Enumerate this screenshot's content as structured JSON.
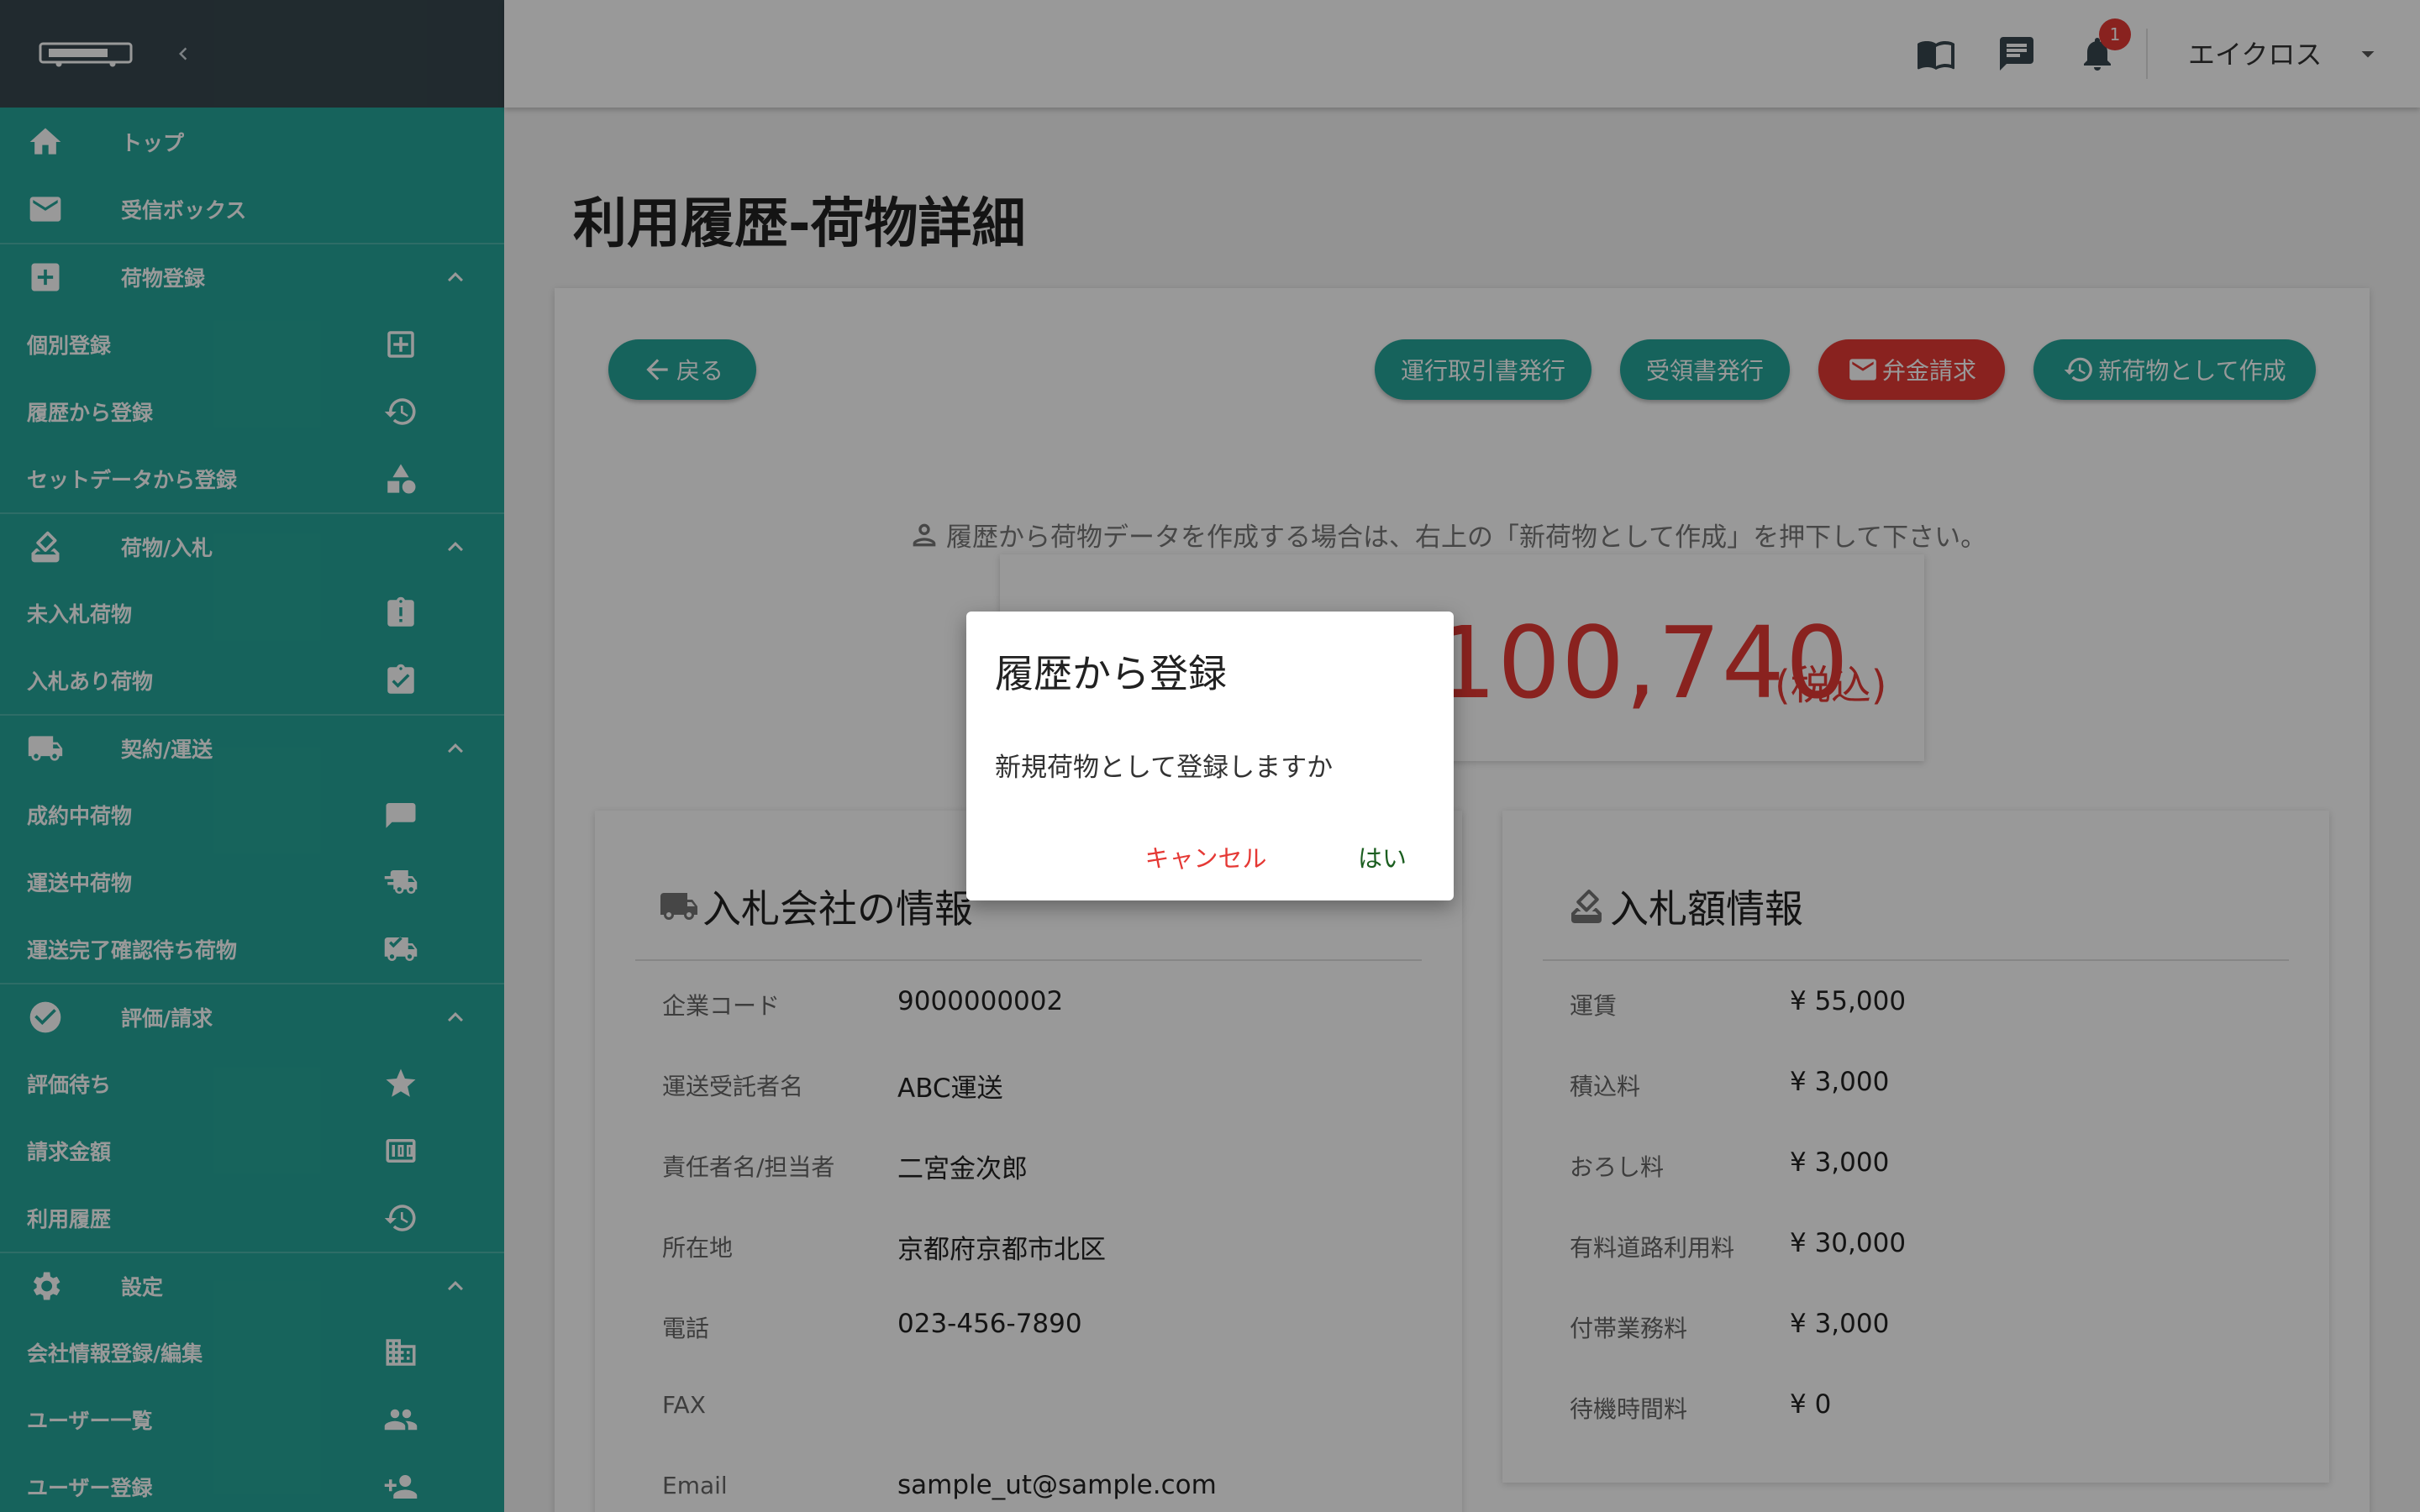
{
  "topbar": {
    "user_name": "エイクロス",
    "notification_count": "1"
  },
  "sidebar": {
    "top": "トップ",
    "inbox": "受信ボックス",
    "cargo_register": "荷物登録",
    "individual_register": "個別登録",
    "history_register": "履歴から登録",
    "set_data_register": "セットデータから登録",
    "cargo_bid": "荷物/入札",
    "unbid_cargo": "未入札荷物",
    "bid_cargo": "入札あり荷物",
    "contract_transport": "契約/運送",
    "contracted_cargo": "成約中荷物",
    "in_transit_cargo": "運送中荷物",
    "awaiting_confirmation_cargo": "運送完了確認待ち荷物",
    "review_billing": "評価/請求",
    "awaiting_review": "評価待ち",
    "billing_amount": "請求金額",
    "usage_history": "利用履歴",
    "settings": "設定",
    "company_info_edit": "会社情報登録/編集",
    "user_list": "ユーザー一覧",
    "user_register": "ユーザー登録"
  },
  "main": {
    "page_title": "利用履歴-荷物詳細",
    "back_label": "戻る",
    "operation_doc_label": "運行取引書発行",
    "receipt_label": "受領書発行",
    "reimbursement_label": "弁金請求",
    "new_cargo_label": "新荷物として作成",
    "notice": "履歴から荷物データを作成する場合は、右上の「新荷物として作成」を押下して下さい。",
    "amount": "100,740",
    "tax_label": "(税込)"
  },
  "bidder_panel": {
    "title": "入札会社の情報",
    "rows": [
      {
        "label": "企業コード",
        "value": "9000000002"
      },
      {
        "label": "運送受託者名",
        "value": "ABC運送"
      },
      {
        "label": "責任者名/担当者",
        "value": "二宮金次郎"
      },
      {
        "label": "所在地",
        "value": "京都府京都市北区"
      },
      {
        "label": "電話",
        "value": "023-456-7890"
      },
      {
        "label": "FAX",
        "value": ""
      },
      {
        "label": "Email",
        "value": "sample_ut@sample.com"
      }
    ]
  },
  "bid_amount_panel": {
    "title": "入札額情報",
    "rows": [
      {
        "label": "運賃",
        "value": "¥ 55,000"
      },
      {
        "label": "積込料",
        "value": "¥ 3,000"
      },
      {
        "label": "おろし料",
        "value": "¥ 3,000"
      },
      {
        "label": "有料道路利用料",
        "value": "¥ 30,000"
      },
      {
        "label": "付帯業務料",
        "value": "¥ 3,000"
      },
      {
        "label": "待機時間料",
        "value": "¥ 0"
      }
    ]
  },
  "dialog": {
    "title": "履歴から登録",
    "message": "新規荷物として登録しますか",
    "cancel_label": "キャンセル",
    "ok_label": "はい"
  },
  "colors": {
    "primary": "#26a69a",
    "sidebar_header": "#37474f",
    "danger": "#e53935"
  }
}
